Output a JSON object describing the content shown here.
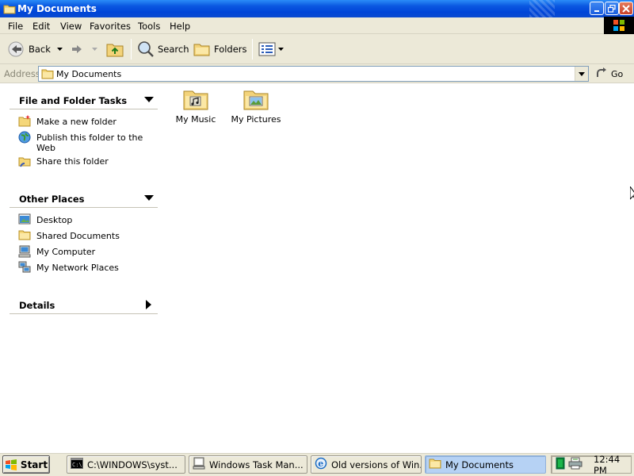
{
  "window": {
    "title": "My Documents"
  },
  "menubar": {
    "items": [
      "File",
      "Edit",
      "View",
      "Favorites",
      "Tools",
      "Help"
    ]
  },
  "toolbar": {
    "back_label": "Back",
    "search_label": "Search",
    "folders_label": "Folders"
  },
  "address": {
    "label": "Address",
    "value": "My Documents",
    "go_label": "Go"
  },
  "left_pane": {
    "file_folder_tasks": {
      "title": "File and Folder Tasks",
      "items": [
        "Make a new folder",
        "Publish this folder to the Web",
        "Share this folder"
      ]
    },
    "other_places": {
      "title": "Other Places",
      "items": [
        "Desktop",
        "Shared Documents",
        "My Computer",
        "My Network Places"
      ]
    },
    "details": {
      "title": "Details"
    }
  },
  "content": {
    "items": [
      {
        "label": "My Music",
        "icon": "music-folder-icon"
      },
      {
        "label": "My Pictures",
        "icon": "pictures-folder-icon"
      }
    ]
  },
  "taskbar": {
    "start_label": "Start",
    "tasks": [
      {
        "label": "C:\\WINDOWS\\syst...",
        "icon": "cmd-icon",
        "active": false
      },
      {
        "label": "Windows Task Man...",
        "icon": "task-manager-icon",
        "active": false
      },
      {
        "label": "Old versions of Win...",
        "icon": "ie-icon",
        "active": false
      },
      {
        "label": "My Documents",
        "icon": "folder-icon",
        "active": true
      }
    ],
    "clock": "12:44 PM"
  },
  "colors": {
    "title_bar": "#0a57e0",
    "chrome": "#ece9d8",
    "active_task": "#b6d2f4"
  }
}
